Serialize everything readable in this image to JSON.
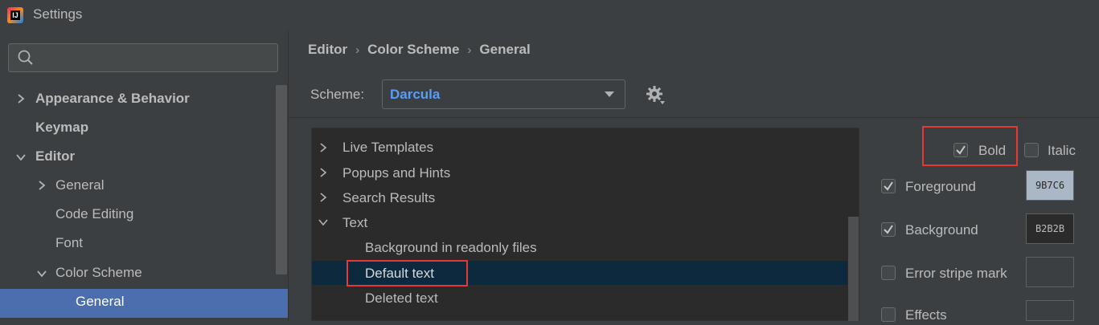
{
  "window": {
    "title": "Settings"
  },
  "sidebar": {
    "search_placeholder": "",
    "items": [
      {
        "label": "Appearance & Behavior"
      },
      {
        "label": "Keymap"
      },
      {
        "label": "Editor"
      },
      {
        "label": "General"
      },
      {
        "label": "Code Editing"
      },
      {
        "label": "Font"
      },
      {
        "label": "Color Scheme"
      },
      {
        "label": "General"
      }
    ]
  },
  "main": {
    "breadcrumb": [
      "Editor",
      "Color Scheme",
      "General"
    ],
    "scheme_label": "Scheme:",
    "scheme_value": "Darcula",
    "tree": [
      {
        "label": "Live Templates"
      },
      {
        "label": "Popups and Hints"
      },
      {
        "label": "Search Results"
      },
      {
        "label": "Text"
      },
      {
        "label": "Background in readonly files"
      },
      {
        "label": "Default text"
      },
      {
        "label": "Deleted text"
      }
    ]
  },
  "attributes": {
    "bold": {
      "label": "Bold",
      "checked": true
    },
    "italic": {
      "label": "Italic",
      "checked": false
    },
    "foreground": {
      "label": "Foreground",
      "checked": true,
      "value": "9B7C6"
    },
    "background": {
      "label": "Background",
      "checked": true,
      "value": "B2B2B"
    },
    "error_stripe": {
      "label": "Error stripe mark",
      "checked": false
    },
    "effects": {
      "label": "Effects",
      "checked": false
    }
  },
  "colors": {
    "accent": "#589df6",
    "selection": "#4b6eaf",
    "tree_selection": "#0d293e",
    "highlight": "#e53935",
    "foreground_swatch": "#a9b7c6",
    "background_swatch": "#2b2b2b"
  }
}
